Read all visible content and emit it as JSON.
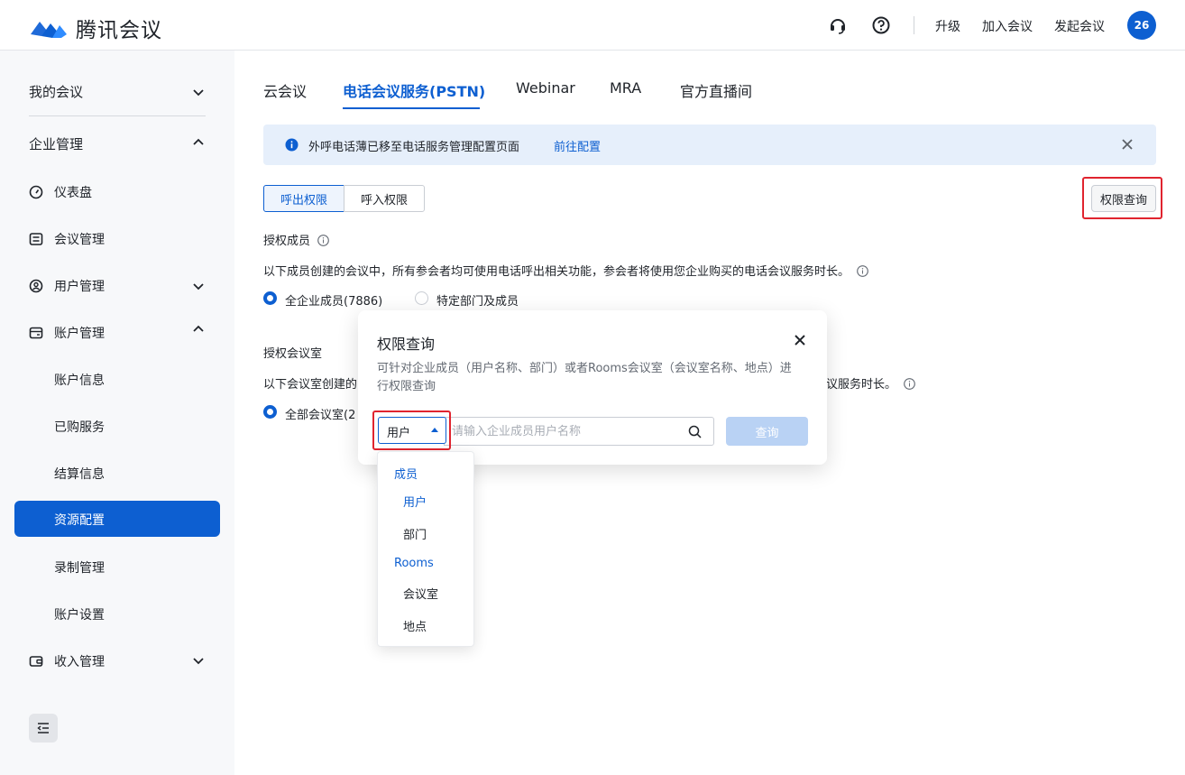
{
  "header": {
    "brand": "腾讯会议",
    "links": {
      "upgrade": "升级",
      "join": "加入会议",
      "start": "发起会议"
    },
    "avatar_text": "26",
    "icons": [
      "headset-icon",
      "help-icon"
    ]
  },
  "sidebar": {
    "my_meetings": "我的会议",
    "enterprise": "企业管理",
    "items": [
      {
        "label": "仪表盘",
        "icon": "dashboard-icon"
      },
      {
        "label": "会议管理",
        "icon": "list-icon"
      },
      {
        "label": "用户管理",
        "icon": "user-icon"
      },
      {
        "label": "账户管理",
        "icon": "account-icon"
      }
    ],
    "account_children": [
      "账户信息",
      "已购服务",
      "结算信息",
      "资源配置",
      "录制管理",
      "账户设置"
    ],
    "active_child": "资源配置",
    "income": "收入管理"
  },
  "tabs": [
    "云会议",
    "电话会议服务(PSTN)",
    "Webinar",
    "MRA",
    "官方直播间"
  ],
  "active_tab": "电话会议服务(PSTN)",
  "notice": {
    "message": "外呼电话薄已移至电话服务管理配置页面",
    "link": "前往配置"
  },
  "segments": {
    "outbound": "呼出权限",
    "inbound": "呼入权限"
  },
  "perm_query_button": "权限查询",
  "authorized_members": {
    "title": "授权成员",
    "desc": "以下成员创建的会议中，所有参会者均可使用电话呼出相关功能，参会者将使用您企业购买的电话会议服务时长。",
    "option_all": "全企业成员(7886)",
    "option_specific": "特定部门及成员"
  },
  "authorized_rooms": {
    "title": "授权会议室",
    "desc_start": "以下会议室创建的",
    "desc_end": "议服务时长。",
    "option_all": "全部会议室(2"
  },
  "modal": {
    "title": "权限查询",
    "desc": "可针对企业成员（用户名称、部门）或者Rooms会议室（会议室名称、地点）进行权限查询",
    "select_value": "用户",
    "search_placeholder": "请输入企业成员用户名称",
    "query_button": "查询"
  },
  "dropdown": {
    "group_members": "成员",
    "opt_user": "用户",
    "opt_dept": "部门",
    "group_rooms": "Rooms",
    "opt_room": "会议室",
    "opt_location": "地点"
  },
  "colors": {
    "brand": "#0d5fd1",
    "highlight": "#e0242f"
  }
}
